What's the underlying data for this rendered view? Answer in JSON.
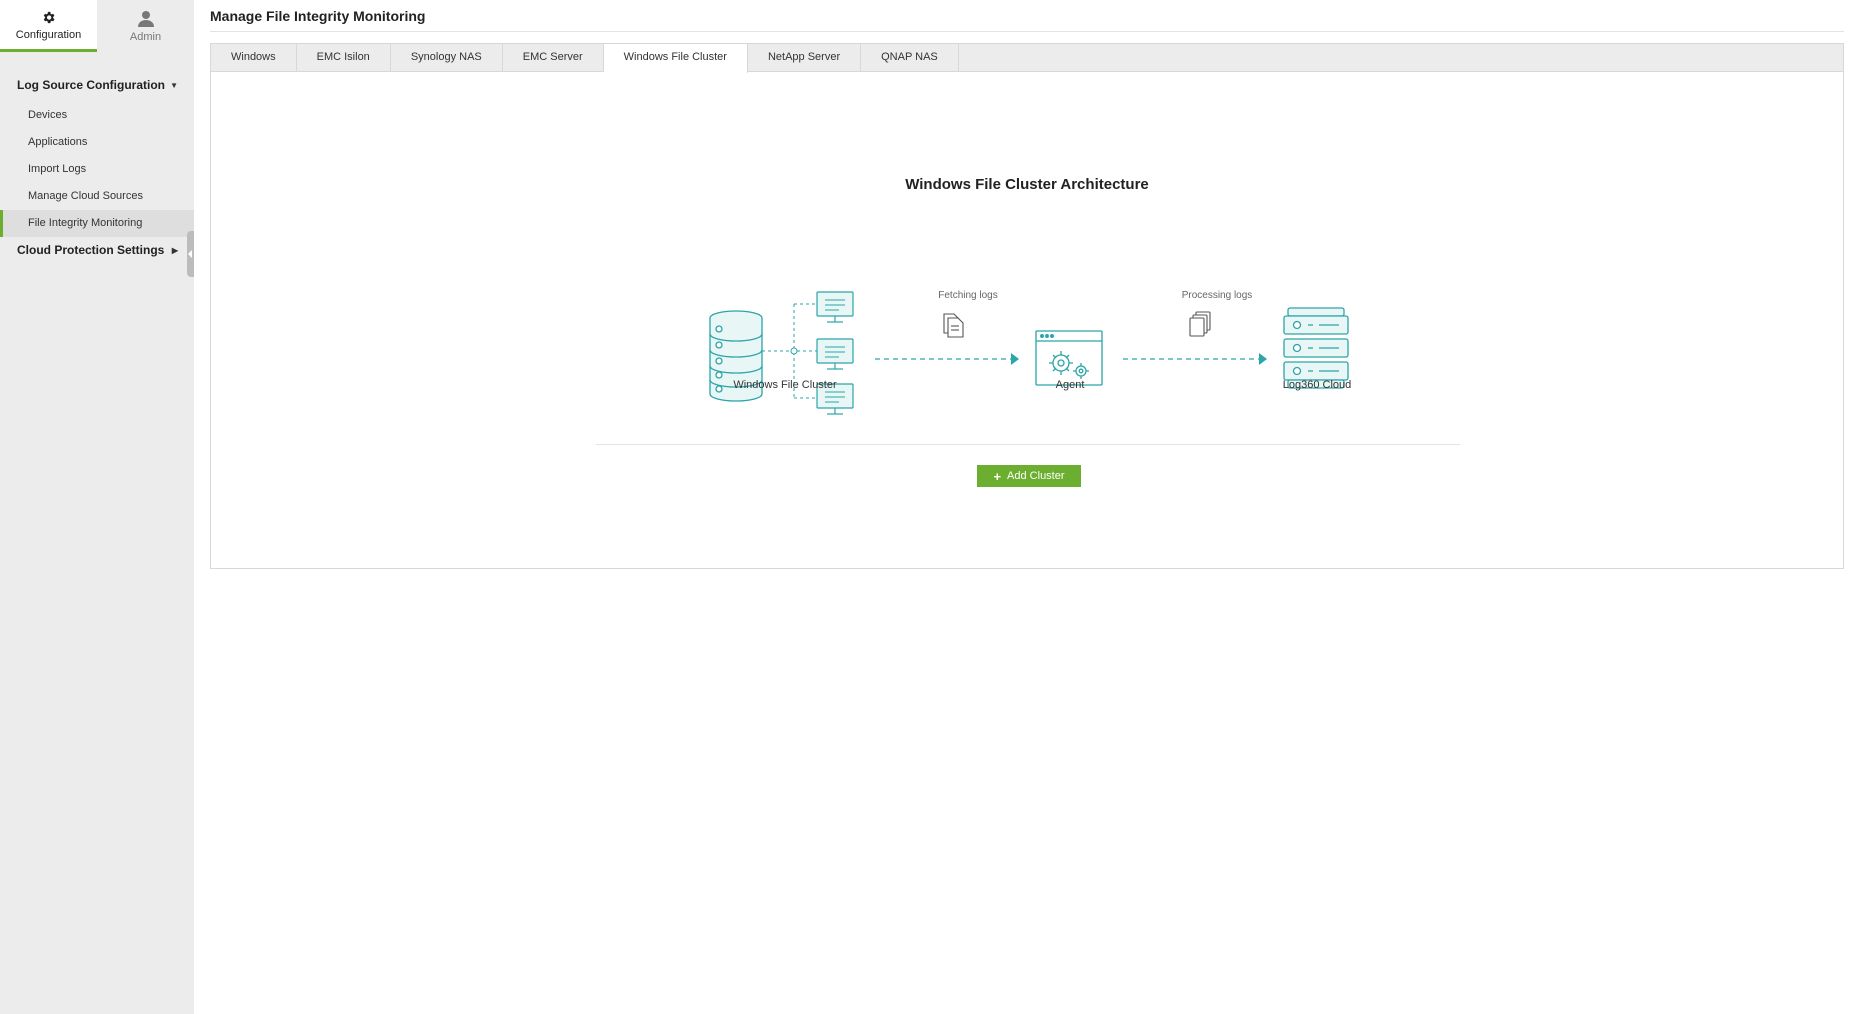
{
  "sidebar": {
    "top_tabs": [
      {
        "label": "Configuration",
        "icon": "gear-icon"
      },
      {
        "label": "Admin",
        "icon": "user-icon"
      }
    ],
    "groups": [
      {
        "label": "Log Source Configuration",
        "items": [
          {
            "label": "Devices"
          },
          {
            "label": "Applications"
          },
          {
            "label": "Import Logs"
          },
          {
            "label": "Manage Cloud Sources"
          },
          {
            "label": "File Integrity Monitoring"
          }
        ]
      },
      {
        "label": "Cloud Protection Settings"
      }
    ]
  },
  "header": {
    "title": "Manage File Integrity Monitoring"
  },
  "tabs": [
    {
      "label": "Windows"
    },
    {
      "label": "EMC Isilon"
    },
    {
      "label": "Synology NAS"
    },
    {
      "label": "EMC Server"
    },
    {
      "label": "Windows File Cluster"
    },
    {
      "label": "NetApp Server"
    },
    {
      "label": "QNAP NAS"
    }
  ],
  "active_tab": "Windows File Cluster",
  "architecture": {
    "title": "Windows File Cluster Architecture",
    "nodes": {
      "cluster": "Windows File Cluster",
      "agent": "Agent",
      "cloud": "Log360 Cloud"
    },
    "flows": {
      "fetch": "Fetching logs",
      "process": "Processing logs"
    }
  },
  "actions": {
    "add_cluster": "Add Cluster"
  },
  "colors": {
    "accent": "#6cae30",
    "diagram_teal": "#2aa5a8",
    "sidebar_bg": "#ececec"
  }
}
